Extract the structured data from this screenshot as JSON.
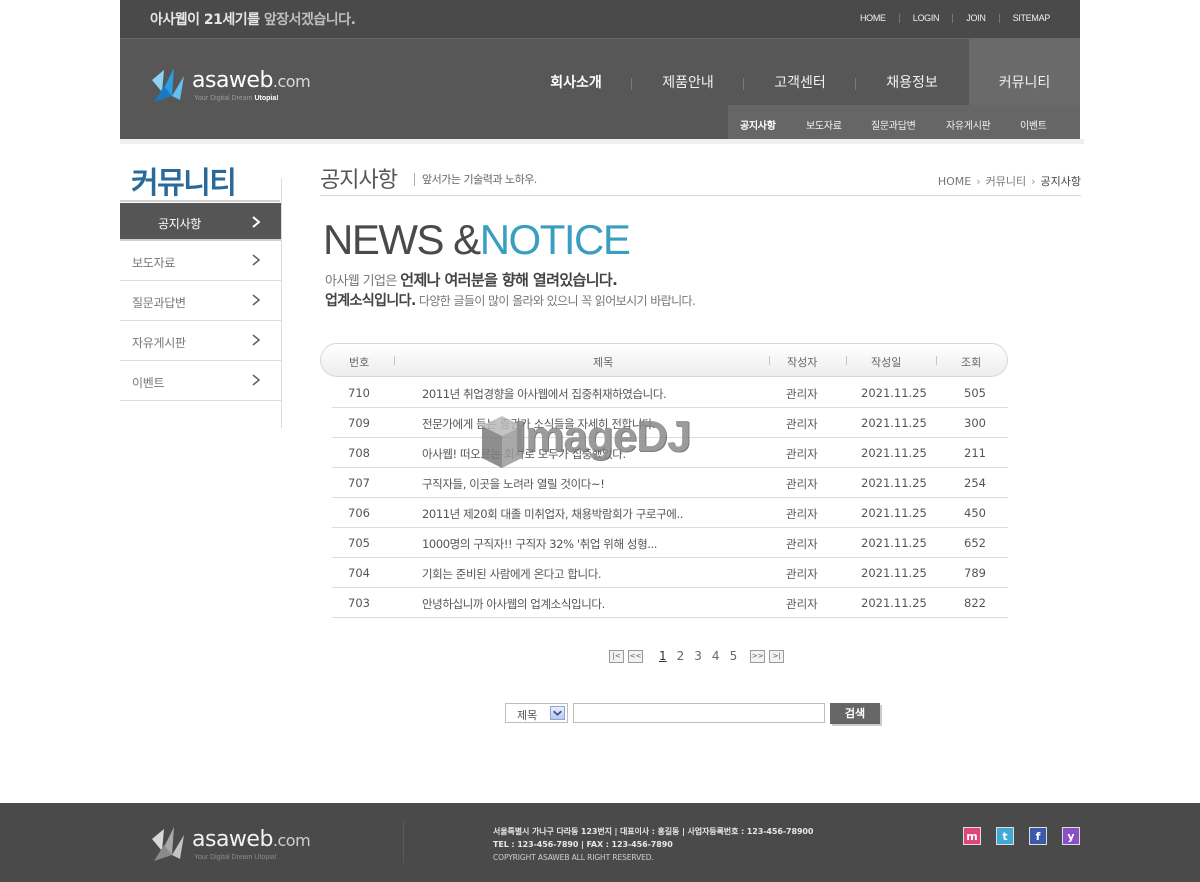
{
  "header": {
    "slogan_main": "아사웹이 21세기를",
    "slogan_highlight": "앞장서겠습니다.",
    "top_links": [
      "HOME",
      "LOGIN",
      "JOIN",
      "SITEMAP"
    ],
    "logo": {
      "brand": "asaweb",
      "dotcom": ".com",
      "tagline": "Your Digital Dream",
      "tagline_bold": "Utopia!"
    },
    "gnb": [
      "회사소개",
      "제품안내",
      "고객센터",
      "채용정보",
      "커뮤니티"
    ],
    "subnav": [
      "공지사항",
      "보도자료",
      "질문과답변",
      "자유게시판",
      "이벤트"
    ]
  },
  "sidebar": {
    "title": "커뮤니티",
    "items": [
      "공지사항",
      "보도자료",
      "질문과답변",
      "자유게시판",
      "이벤트"
    ]
  },
  "page": {
    "title": "공지사항",
    "subtitle": "앞서가는 기술력과 노하우.",
    "breadcrumb": [
      "HOME",
      "커뮤니티",
      "공지사항"
    ],
    "hero_dark": "NEWS &",
    "hero_blue": "NOTICE",
    "intro1_plain": "아사웹 기업은",
    "intro1_bold": "언제나 여러분을 향해 열려있습니다.",
    "intro2_bold": "업계소식입니다.",
    "intro2_plain": "다양한 글들이 많이 올라와 있으니 꼭 읽어보시기 바랍니다."
  },
  "board": {
    "columns": [
      "번호",
      "제목",
      "작성자",
      "작성일",
      "조회"
    ],
    "rows": [
      {
        "no": "710",
        "title": "2011년 취업경향을 아사웹에서 집중취재하였습니다.",
        "author": "관리자",
        "date": "2021.11.25",
        "views": "505"
      },
      {
        "no": "709",
        "title": "전문가에게 듣는 증권가 소식들을 자세히 전합니다.",
        "author": "관리자",
        "date": "2021.11.25",
        "views": "300"
      },
      {
        "no": "708",
        "title": "아사웹! 떠오르는 회사로 모두가 집중했었다.",
        "author": "관리자",
        "date": "2021.11.25",
        "views": "211"
      },
      {
        "no": "707",
        "title": "구직자들, 이곳을 노려라 열릴 것이다~!",
        "author": "관리자",
        "date": "2021.11.25",
        "views": "254"
      },
      {
        "no": "706",
        "title": "2011년 제20회 대졸 미취업자, 채용박람회가 구로구에..",
        "author": "관리자",
        "date": "2021.11.25",
        "views": "450"
      },
      {
        "no": "705",
        "title": "1000명의 구직자!! 구직자 32% '취업 위해 성형...",
        "author": "관리자",
        "date": "2021.11.25",
        "views": "652"
      },
      {
        "no": "704",
        "title": "기회는 준비된 사람에게 온다고 합니다.",
        "author": "관리자",
        "date": "2021.11.25",
        "views": "789"
      },
      {
        "no": "703",
        "title": "안녕하십니까 아사웹의 업계소식입니다.",
        "author": "관리자",
        "date": "2021.11.25",
        "views": "822"
      }
    ]
  },
  "watermark": "ImageDJ",
  "pagination": {
    "pages": [
      "1",
      "2",
      "3",
      "4",
      "5"
    ],
    "current": "1",
    "first": "|<",
    "prev": "<<",
    "next": ">>",
    "last": ">|"
  },
  "search": {
    "field": "제목",
    "button": "검색",
    "value": ""
  },
  "footer": {
    "logo": {
      "brand": "asaweb",
      "dotcom": ".com",
      "tagline": "Your Digital Dream Utopia!"
    },
    "line1": "서울특별시 가나구 다라동 123번지  |  대표이사 : 홍길동  |  사업자등록번호 : 123-456-78900",
    "line2": "TEL : 123-456-7890  |  FAX : 123-456-7890",
    "copyright": "COPYRIGHT ASAWEB ALL RIGHT RESERVED.",
    "sns": [
      {
        "name": "me2day",
        "glyph": "m",
        "color": "#e0457b"
      },
      {
        "name": "twitter",
        "glyph": "t",
        "color": "#3fa9d8"
      },
      {
        "name": "facebook",
        "glyph": "f",
        "color": "#3b5ba8"
      },
      {
        "name": "yozm",
        "glyph": "y",
        "color": "#8a4ec6"
      }
    ]
  },
  "colors": {
    "accent_blue": "#3a9ec0",
    "title_blue": "#2a6a9a",
    "header_dark": "#4a4a4a"
  }
}
